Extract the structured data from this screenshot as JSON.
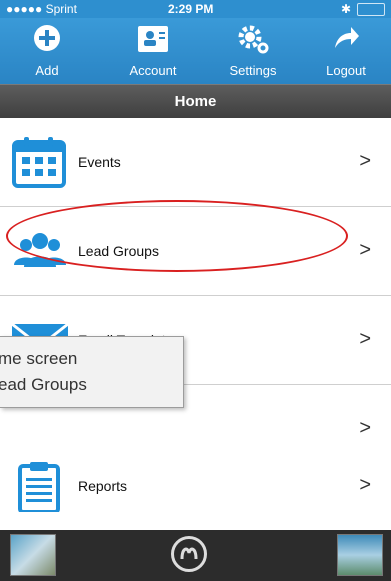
{
  "status": {
    "carrier": "●●●●● Sprint",
    "time": "2:29 PM"
  },
  "toolbar": {
    "add": "Add",
    "account": "Account",
    "settings": "Settings",
    "logout": "Logout"
  },
  "header": {
    "title": "Home"
  },
  "menu": [
    {
      "label": "Events",
      "chevron": ">"
    },
    {
      "label": "Lead Groups",
      "chevron": ">"
    },
    {
      "label": "Email Templates",
      "chevron": ">"
    },
    {
      "label": "",
      "chevron": ">"
    },
    {
      "label": "Reports",
      "chevron": ">"
    }
  ],
  "tooltip": {
    "line1": "me screen",
    "line2": "ead Groups"
  },
  "colors": {
    "brand_blue": "#2e8fcf",
    "dark_bar": "#3e3e3e",
    "annotation_red": "#d92020"
  }
}
